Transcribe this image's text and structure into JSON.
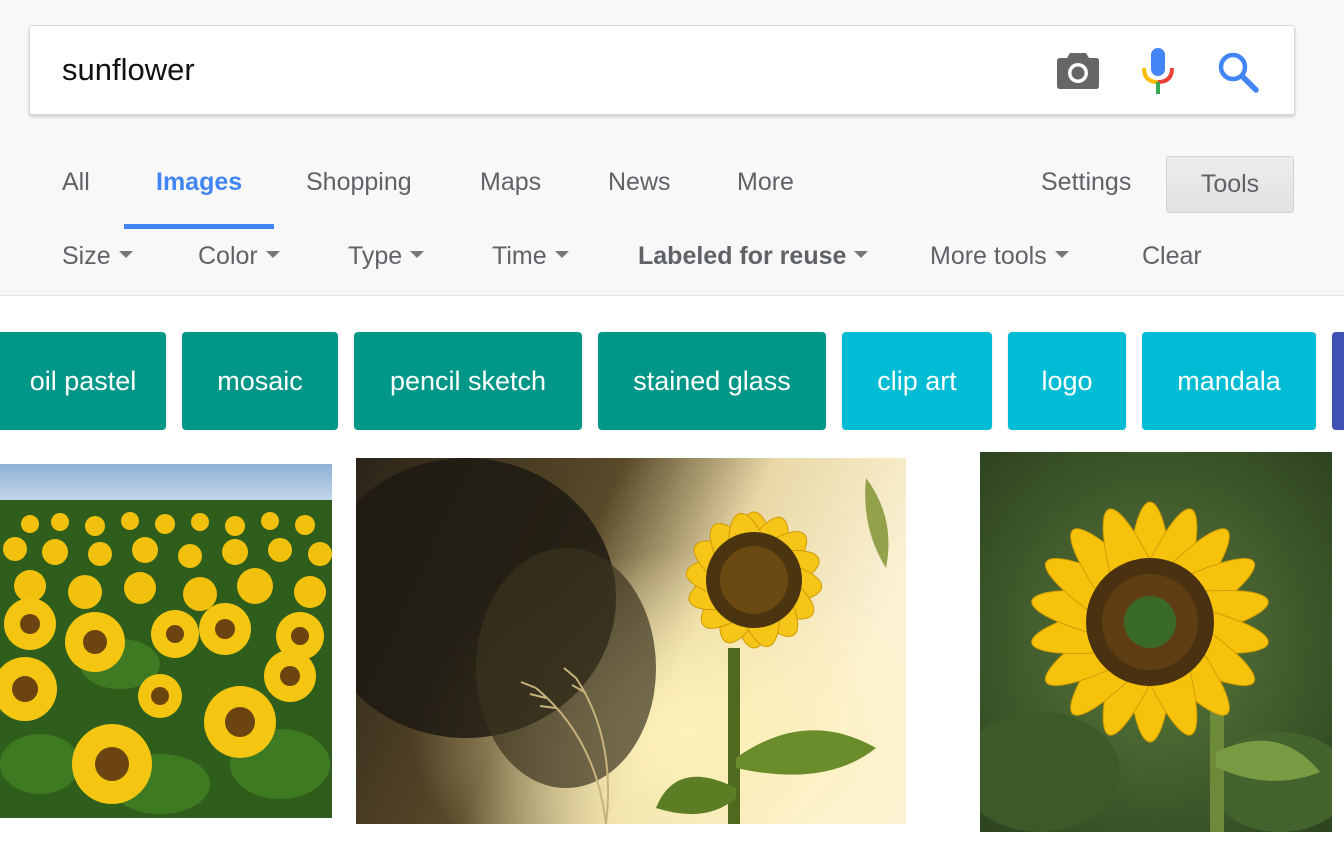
{
  "search": {
    "query": "sunflower"
  },
  "icons": {
    "camera": "camera-icon",
    "mic": "microphone-icon",
    "search": "search-icon"
  },
  "colors": {
    "accent": "#4285f4",
    "chip_teal": "#009688",
    "chip_cyan": "#00bcd4",
    "chip_indigo": "#3f51b5"
  },
  "tabs": [
    {
      "label": "All",
      "active": false
    },
    {
      "label": "Images",
      "active": true
    },
    {
      "label": "Shopping",
      "active": false
    },
    {
      "label": "Maps",
      "active": false
    },
    {
      "label": "News",
      "active": false
    },
    {
      "label": "More",
      "active": false
    }
  ],
  "toolbar": {
    "settings_label": "Settings",
    "tools_label": "Tools"
  },
  "filters": [
    {
      "label": "Size",
      "dropdown": true
    },
    {
      "label": "Color",
      "dropdown": true
    },
    {
      "label": "Type",
      "dropdown": true
    },
    {
      "label": "Time",
      "dropdown": true
    },
    {
      "label": "Labeled for reuse",
      "dropdown": true,
      "active": true
    },
    {
      "label": "More tools",
      "dropdown": true
    },
    {
      "label": "Clear",
      "dropdown": false
    }
  ],
  "chips": [
    {
      "label": "oil pastel",
      "color": "#009688"
    },
    {
      "label": "mosaic",
      "color": "#009688"
    },
    {
      "label": "pencil sketch",
      "color": "#009688"
    },
    {
      "label": "stained glass",
      "color": "#009688"
    },
    {
      "label": "clip art",
      "color": "#00bcd4"
    },
    {
      "label": "logo",
      "color": "#00bcd4"
    },
    {
      "label": "mandala",
      "color": "#00bcd4"
    },
    {
      "label": "",
      "color": "#3f51b5"
    }
  ]
}
